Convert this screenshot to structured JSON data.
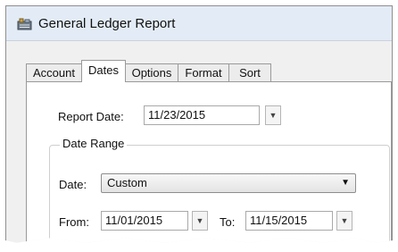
{
  "window": {
    "title": "General Ledger Report"
  },
  "tabs": [
    {
      "label": "Account",
      "active": false
    },
    {
      "label": "Dates",
      "active": true
    },
    {
      "label": "Options",
      "active": false
    },
    {
      "label": "Format",
      "active": false
    },
    {
      "label": "Sort",
      "active": false
    }
  ],
  "dates": {
    "report_date_label": "Report Date:",
    "report_date_value": "11/23/2015",
    "date_range_label": "Date Range",
    "date_label": "Date:",
    "date_value": "Custom",
    "from_label": "From:",
    "from_value": "11/01/2015",
    "to_label": "To:",
    "to_value": "11/15/2015"
  },
  "icons": {
    "title": "ledger-app-icon",
    "dropdown": "triangle-down-icon"
  }
}
